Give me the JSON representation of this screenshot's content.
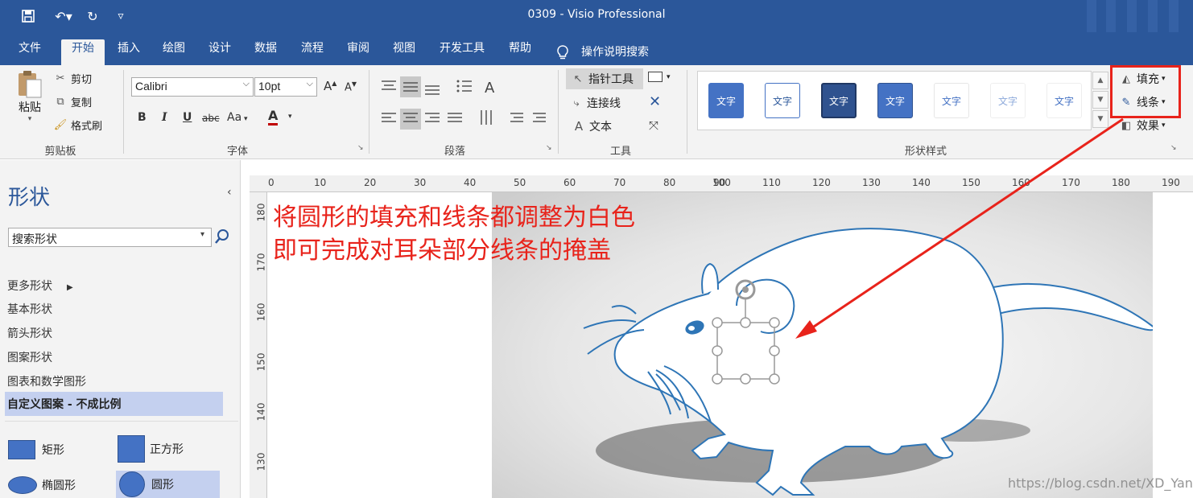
{
  "window": {
    "title": "0309  -  Visio Professional"
  },
  "qat": {
    "undo": "↶▾",
    "redo": "↻",
    "more": "▿"
  },
  "tabs": [
    "文件",
    "开始",
    "插入",
    "绘图",
    "设计",
    "数据",
    "流程",
    "审阅",
    "视图",
    "开发工具",
    "帮助"
  ],
  "tell_me": "操作说明搜索",
  "clipboard": {
    "paste": "粘贴",
    "cut": "剪切",
    "copy": "复制",
    "format_painter": "格式刷",
    "group_label": "剪贴板"
  },
  "font": {
    "name": "Calibri",
    "size": "10pt",
    "group_label": "字体",
    "bold": "B",
    "italic": "I",
    "underline": "U",
    "strike": "abc",
    "case": "Aa",
    "color_glyph": "A",
    "grow": "A",
    "shrink": "A",
    "accent": "#c00000"
  },
  "paragraph": {
    "group_label": "段落"
  },
  "tools": {
    "pointer": "指针工具",
    "connector": "连接线",
    "text": "文本",
    "group_label": "工具"
  },
  "shape_styles": {
    "tile_text": "文字",
    "group_label": "形状样式",
    "fill": "填充",
    "line": "线条",
    "effects": "效果"
  },
  "shapes_panel": {
    "title": "形状",
    "search_placeholder": "搜索形状",
    "more_shapes": "更多形状",
    "items": [
      "基本形状",
      "箭头形状",
      "图案形状",
      "图表和数学图形"
    ],
    "selected_stencil": "自定义图案 - 不成比例",
    "masters": [
      "矩形",
      "正方形",
      "椭圆形",
      "圆形"
    ]
  },
  "ruler": {
    "h": [
      "0",
      "10",
      "20",
      "30",
      "40",
      "50",
      "60",
      "70",
      "80",
      "90",
      "100",
      "110",
      "120",
      "130",
      "140",
      "150",
      "160",
      "170",
      "180",
      "190"
    ],
    "v": [
      "180",
      "170",
      "160",
      "150",
      "140",
      "130"
    ]
  },
  "annotation": {
    "line1": "将圆形的填充和线条都调整为白色",
    "line2": "即可完成对耳朵部分线条的掩盖",
    "color": "#e8231b"
  },
  "watermark": "https://blog.csdn.net/XD_Yangi",
  "colors": {
    "brand": "#2b579a",
    "shape_blue": "#4472c4",
    "outline": "#2e75b6"
  }
}
